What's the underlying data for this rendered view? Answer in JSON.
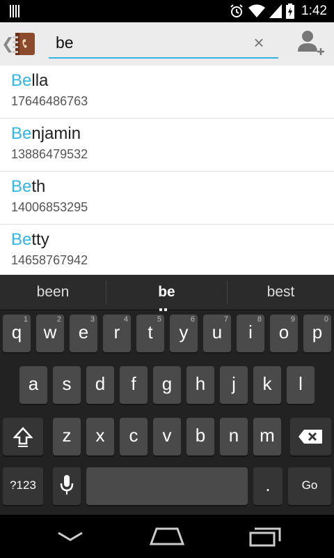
{
  "status_bar": {
    "time": "1:42"
  },
  "search": {
    "query": "be"
  },
  "contacts": [
    {
      "highlight": "Be",
      "rest": "lla",
      "phone": "17646486763"
    },
    {
      "highlight": "Be",
      "rest": "njamin",
      "phone": "13886479532"
    },
    {
      "highlight": "Be",
      "rest": "th",
      "phone": "14006853295"
    },
    {
      "highlight": "Be",
      "rest": "tty",
      "phone": "14658767942"
    }
  ],
  "suggestions": [
    "been",
    "be",
    "best"
  ],
  "keyboard": {
    "row1": [
      {
        "k": "q",
        "n": "1"
      },
      {
        "k": "w",
        "n": "2"
      },
      {
        "k": "e",
        "n": "3"
      },
      {
        "k": "r",
        "n": "4"
      },
      {
        "k": "t",
        "n": "5"
      },
      {
        "k": "y",
        "n": "6"
      },
      {
        "k": "u",
        "n": "7"
      },
      {
        "k": "i",
        "n": "8"
      },
      {
        "k": "o",
        "n": "9"
      },
      {
        "k": "p",
        "n": "0"
      }
    ],
    "row2": [
      "a",
      "s",
      "d",
      "f",
      "g",
      "h",
      "j",
      "k",
      "l"
    ],
    "row3": [
      "z",
      "x",
      "c",
      "v",
      "b",
      "n",
      "m"
    ],
    "symbols_label": "?123",
    "period_label": ".",
    "go_label": "Go"
  },
  "colors": {
    "accent": "#33b5e5",
    "list_bg": "#ffffff",
    "keyboard_bg": "#222222"
  }
}
